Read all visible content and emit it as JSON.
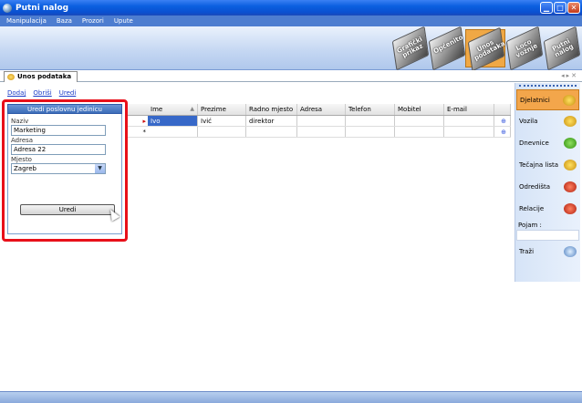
{
  "window": {
    "title": "Putni nalog"
  },
  "menu": [
    "Manipulacija",
    "Baza",
    "Prozori",
    "Upute"
  ],
  "toolbar": {
    "tools": [
      {
        "label": "Grafički prikaz",
        "color": "#6a6a6a"
      },
      {
        "label": "Općenito",
        "color": "#777777"
      },
      {
        "label": "Unos podataka",
        "color": "#f0a845"
      },
      {
        "label": "Loco vožnje",
        "color": "#6a6a6a"
      },
      {
        "label": "Putni nalog",
        "color": "#6a6a6a"
      }
    ]
  },
  "tab": {
    "label": "Unos podataka"
  },
  "actions": [
    "Dodaj",
    "Obriši",
    "Uredi"
  ],
  "grid": {
    "columns": [
      "Ime",
      "Prezime",
      "Radno mjesto",
      "Adresa",
      "Telefon",
      "Mobitel",
      "E-mail"
    ],
    "rows": [
      {
        "indicator": "▸",
        "ime": "Ivo",
        "prezime": "Ivić",
        "radno_mjesto": "direktor",
        "adresa": "",
        "telefon": "",
        "mobitel": "",
        "email": ""
      },
      {
        "indicator": "*",
        "ime": "",
        "prezime": "",
        "radno_mjesto": "",
        "adresa": "",
        "telefon": "",
        "mobitel": "",
        "email": ""
      }
    ]
  },
  "edit_panel": {
    "title": "Uredi poslovnu jedinicu",
    "naziv_label": "Naziv",
    "naziv_value": "Marketing",
    "adresa_label": "Adresa",
    "adresa_value": "Adresa 22",
    "mjesto_label": "Mjesto",
    "mjesto_value": "Zagreb",
    "button_label": "Uredi"
  },
  "side_panel": {
    "items": [
      {
        "label": "Djelatnici",
        "icon": "people-icon",
        "color": "#e8c020"
      },
      {
        "label": "Vozila",
        "icon": "car-icon",
        "color": "#e8c020"
      },
      {
        "label": "Dnevnice",
        "icon": "money-icon",
        "color": "#50b030"
      },
      {
        "label": "Tečajna lista",
        "icon": "exchange-icon",
        "color": "#e8c020"
      },
      {
        "label": "Odredišta",
        "icon": "destination-icon",
        "color": "#d83020"
      },
      {
        "label": "Relacije",
        "icon": "route-icon",
        "color": "#d83020"
      }
    ],
    "search_label": "Pojam :",
    "search_button": "Traži"
  }
}
